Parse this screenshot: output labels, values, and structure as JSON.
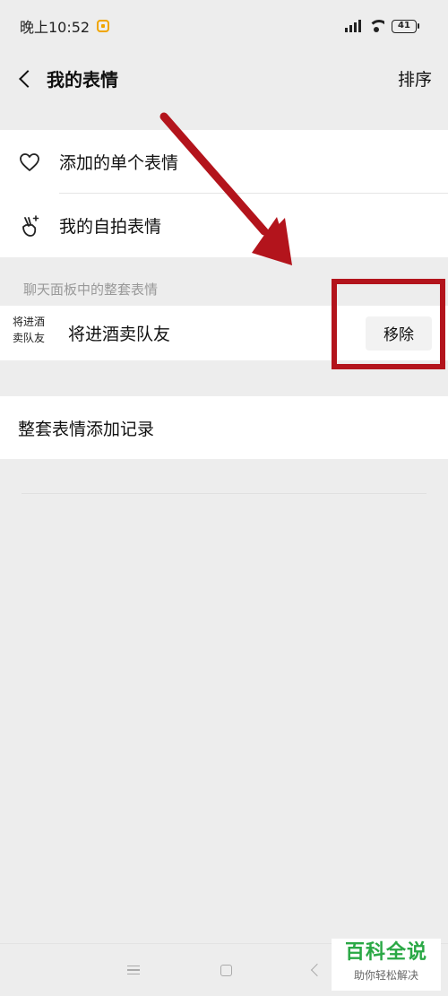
{
  "status_bar": {
    "time": "晚上10:52",
    "battery": "41"
  },
  "nav": {
    "title": "我的表情",
    "sort_label": "排序"
  },
  "menu": {
    "items": [
      {
        "label": "添加的单个表情",
        "icon": "heart-icon"
      },
      {
        "label": "我的自拍表情",
        "icon": "selfie-hand-icon"
      }
    ]
  },
  "section": {
    "title": "聊天面板中的整套表情"
  },
  "packs": [
    {
      "thumb_line1": "将进酒",
      "thumb_line2": "卖队友",
      "name": "将进酒卖队友",
      "action_label": "移除"
    }
  ],
  "record": {
    "label": "整套表情添加记录"
  },
  "watermark": {
    "title": "百科全说",
    "subtitle": "助你轻松解决"
  },
  "colors": {
    "annotation": "#b3141c",
    "watermark_green": "#2aa845"
  }
}
